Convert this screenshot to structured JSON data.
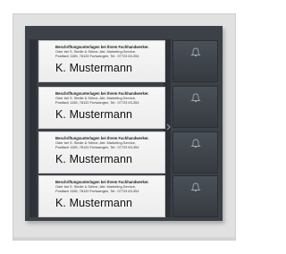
{
  "nameplates": [
    {
      "line1": "Beschriftungsunterlagen bei Ihrem Fachhandwerker.",
      "line2": "Oder bei S. Siedle & Söhne, Abt. Marketing-Service,",
      "line3": "Postfach 1155, 78120 Furtwangen, Tel.: 07723 63-354",
      "name": "K. Mustermann"
    },
    {
      "line1": "Beschriftungsunterlagen bei Ihrem Fachhandwerker.",
      "line2": "Oder bei S. Siedle & Söhne, Abt. Marketing-Service,",
      "line3": "Postfach 1155, 78120 Furtwangen, Tel.: 07723 63-354",
      "name": "K. Mustermann"
    },
    {
      "line1": "Beschriftungsunterlagen bei Ihrem Fachhandwerker.",
      "line2": "Oder bei S. Siedle & Söhne, Abt. Marketing-Service,",
      "line3": "Postfach 1155, 78120 Furtwangen, Tel.: 07723 63-354",
      "name": "K. Mustermann"
    },
    {
      "line1": "Beschriftungsunterlagen bei Ihrem Fachhandwerker.",
      "line2": "Oder bei S. Siedle & Söhne, Abt. Marketing-Service,",
      "line3": "Postfach 1155, 78120 Furtwangen, Tel.: 07723 63-354",
      "name": "K. Mustermann"
    }
  ],
  "bell_buttons": [
    {
      "icon": "bell-icon"
    },
    {
      "icon": "bell-icon"
    },
    {
      "icon": "bell-icon"
    },
    {
      "icon": "bell-icon"
    }
  ],
  "colors": {
    "panel": "#3c4148",
    "button": "#454b53",
    "label_bg": "#f2f2f2",
    "plate_bg": "#e1e1e1"
  }
}
